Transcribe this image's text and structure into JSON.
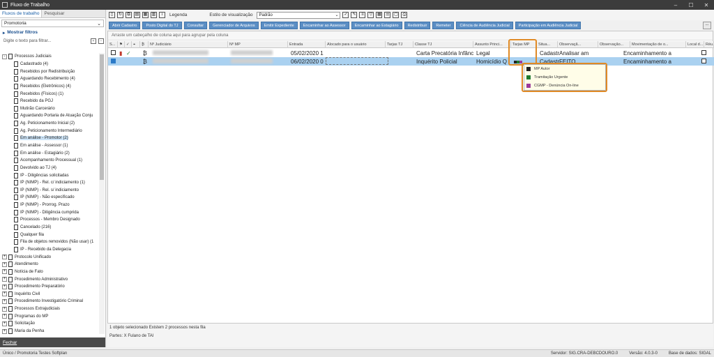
{
  "window": {
    "title": "Fluxo de Trabalho"
  },
  "left_panel": {
    "tabs": [
      "Fluxos de trabalho",
      "Pesquisar"
    ],
    "selector_value": "Promotoria",
    "filters_label": "Mostrar filtros",
    "search_placeholder": "Digite o texto para filtrar...",
    "tree": [
      {
        "label": "Processos Judiciais",
        "level": 0,
        "expander": "-"
      },
      {
        "label": "Cadastrado (4)",
        "level": 1
      },
      {
        "label": "Recebidos por Redistribuição",
        "level": 1
      },
      {
        "label": "Aguardando Recebimento (4)",
        "level": 1
      },
      {
        "label": "Recebidos (Eletrônicos) (4)",
        "level": 1
      },
      {
        "label": "Recebidos (Físicos) (1)",
        "level": 1
      },
      {
        "label": "Recebido da PGJ",
        "level": 1
      },
      {
        "label": "Mutirão Carcerário",
        "level": 1
      },
      {
        "label": "Aguardando Portaria de Atuação Conju",
        "level": 1
      },
      {
        "label": "Ag. Peticionamento Inicial (2)",
        "level": 1
      },
      {
        "label": "Ag. Peticionamento Intermediário",
        "level": 1
      },
      {
        "label": "Em análise - Promotor (2)",
        "level": 1,
        "selected": true
      },
      {
        "label": "Em análise - Assessor (1)",
        "level": 1
      },
      {
        "label": "Em análise - Estagiário (2)",
        "level": 1
      },
      {
        "label": "Acompanhamento Processual (1)",
        "level": 1
      },
      {
        "label": "Devolvido ao TJ (4)",
        "level": 1
      },
      {
        "label": "IP - Diligências solicitadas",
        "level": 1
      },
      {
        "label": "IP (NIMP) - Rel. c/ indiciamento (1)",
        "level": 1
      },
      {
        "label": "IP (NIMP) - Rel. s/ indiciamento",
        "level": 1
      },
      {
        "label": "IP (NIMP) - Não especificado",
        "level": 1
      },
      {
        "label": "IP (NIMP) - Prorrog. Prazo",
        "level": 1
      },
      {
        "label": "IP (NIMP) - Diligência cumprida",
        "level": 1
      },
      {
        "label": "Processos - Membro Designado",
        "level": 1
      },
      {
        "label": "Cancelado (216)",
        "level": 1
      },
      {
        "label": "Qualquer fila",
        "level": 1
      },
      {
        "label": "Fila de objetos removidos (Não usar) (1",
        "level": 1
      },
      {
        "label": "IP - Recebido da Delegacia",
        "level": 1
      },
      {
        "label": "Protocolo Unificado",
        "level": 0,
        "expander": "+"
      },
      {
        "label": "Atendimento",
        "level": 0,
        "expander": "+"
      },
      {
        "label": "Notícia de Fato",
        "level": 0,
        "expander": "+"
      },
      {
        "label": "Procedimento Administrativo",
        "level": 0,
        "expander": "+"
      },
      {
        "label": "Procedimento Preparatório",
        "level": 0,
        "expander": "+"
      },
      {
        "label": "Inquérito Civil",
        "level": 0,
        "expander": "+"
      },
      {
        "label": "Procedimento Investigatório Criminal",
        "level": 0,
        "expander": "+"
      },
      {
        "label": "Processos Extrajudiciais",
        "level": 0,
        "expander": "+"
      },
      {
        "label": "Programas do MP",
        "level": 0,
        "expander": "+"
      },
      {
        "label": "Solicitação",
        "level": 0,
        "expander": "+"
      },
      {
        "label": "Maria da Penha",
        "level": 0,
        "expander": "+"
      }
    ],
    "close_label": "Fechar"
  },
  "toolbar": {
    "legend_label": "Legenda",
    "view_style_label": "Estilo de visualização",
    "view_style_value": "Padrão"
  },
  "actions": [
    "Abrir Cadastro",
    "Posto Digital do TJ",
    "Consultar",
    "Gerenciador de Arquivos",
    "Emitir Expediente",
    "Encaminhar ao Assessor",
    "Encaminhar ao Estagiário",
    "Redistribuir",
    "Remeter",
    "Ciência de Audiência Judicial",
    "Participação em Audiência Judicial"
  ],
  "more_label": "...",
  "grid": {
    "group_hint": "Arraste um cabeçalho de coluna aqui para agrupar pela coluna",
    "columns": [
      "S...",
      "Nº Judiciário",
      "Nº MP",
      "Entrada",
      "Alocado para o usuário",
      "Tarjas TJ",
      "Classe TJ",
      "Assunto Princi...",
      "Tarjas MP",
      "Situa...",
      "Observaçã...",
      "Observação...",
      "Movimentação de o...",
      "Local d...",
      "Réu..."
    ],
    "rows": [
      {
        "entrada": "05/02/2020 1",
        "classe": "Carta Precatória Infânc",
        "assunto": "Legal",
        "situacao": "Cadastr",
        "observacao": "Analisar am",
        "movimentacao": "Encaminhamento a"
      },
      {
        "entrada": "06/02/2020 0",
        "classe": "Inquérito Policial",
        "assunto": "Homicídio Q",
        "situacao": "Cadastr",
        "observacao": "FEITO",
        "movimentacao": "Encaminhamento a"
      }
    ]
  },
  "tarjas_popup": [
    {
      "label": "MP Autor",
      "color": "#222222"
    },
    {
      "label": "Tramitação Urgente",
      "color": "#1f7a2e"
    },
    {
      "label": "CGMP - Denúncia On-line",
      "color": "#9b3a9b"
    }
  ],
  "status": {
    "line1": "1 objeto selecionado   Existem 2 processos nesta fila",
    "line2": "Partes:  X  Fulano de TAl"
  },
  "footer": {
    "left": "Único / Promotoria Testes Softplan",
    "server": "Servidor: SIG.CRA-DEBCDOURO.0",
    "version": "Versão: 4.0.3-0",
    "database": "Base de dados: SIGAL"
  }
}
